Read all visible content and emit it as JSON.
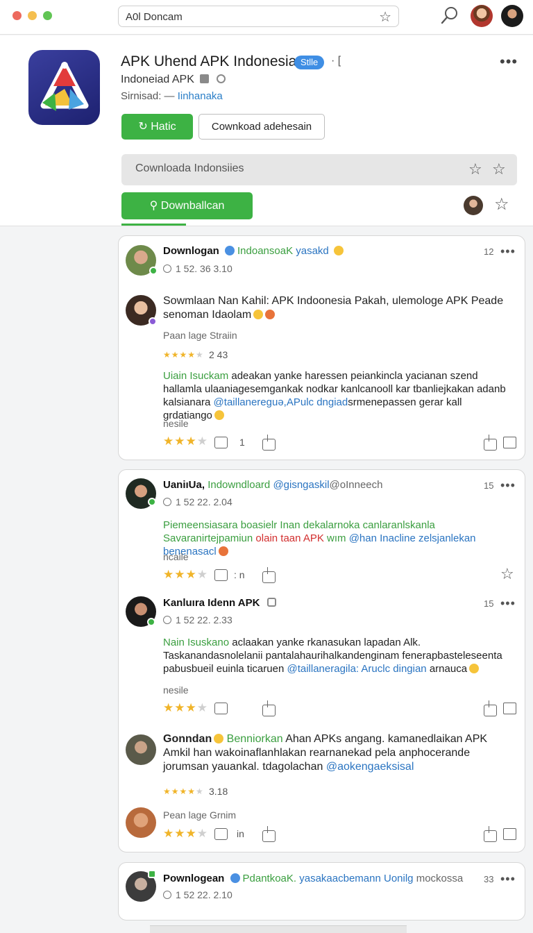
{
  "browser": {
    "address_text": "A0l Doncam"
  },
  "app": {
    "title": "APK Uhend APK Indonesia",
    "badge": "Stlle",
    "badge_extra": "· [",
    "subtitle": "Indoneiad APK",
    "meta_label": "Sirnisad: —",
    "meta_link": "Iinhanaka",
    "install_label": "Hatic",
    "outline_button_label": "Cownkoad adehesain",
    "search_placeholder": "Cownloada Indonsiies",
    "download_label": "Downballcan"
  },
  "reviews": [
    {
      "name": "Downlogan",
      "tag": "IndoansoaK",
      "tag2": "yasakd",
      "time": "1 52. 36 3.10",
      "count": "12",
      "sub": [
        {
          "text": "Sowmlaan Nan Kahil: APK Indoonesia Pakah, ulemologe APK Peade senoman Idaolam",
          "label": "Paan lage Straiin",
          "rating": "2 43",
          "body_green": "Uiain Isuckam",
          "body_text": "adeakan yanke haressen peiankincla yacianan szend hallamla ulaaniagesemgankak nodkar kanlcanooll kar tbanliejkakan adanb kalsianara",
          "body_blue": "@taillanereguə,APulc dngiad",
          "body_text2": "srmenepassen gerar kall grdatiango",
          "footer_label": "nesile",
          "likes": "1"
        }
      ]
    },
    {
      "name": "UaniıUa,",
      "tag": "Indowndloard",
      "tag2": "@gisngaskil",
      "tag3": "@oInneech",
      "time": "1 52 22. 2.04",
      "count": "15",
      "body_green": "Piemeensiasara boasielr Inan dekalarnoka canlaranlskanla Savaranirtejpamiun",
      "body_red": "olain taan APK",
      "body_mid": "wım",
      "body_blue": "@han Inacline zelsjanlekan benenasacl",
      "footer_label": "ncaile",
      "likes": ": n"
    },
    {
      "name": "Kanluıra Idenn APK",
      "time": "1 52 22. 2.33",
      "count": "15",
      "body_green": "Nain Isuskano",
      "body_text": "aclaakan yanke rkanasukan lapadan Alk. Taskanandasnolelanii pantalahaurihalkandenginam fenerapbasteleseenta pabusbueil euinla ticaruen",
      "body_blue": "@taillaneragila: Aruclc dingian",
      "body_text2": "arnauca",
      "footer_label": "nesile"
    },
    {
      "name": "Gonndan",
      "tag": "Benniorkan",
      "body_text": "Ahan APKs angang. kamanedlaikan APK Amkil han wakoinaflanhlakan rearnanekad pela anphocerande jorumsan yauankal. tdagolachan",
      "body_blue": "@aokengaeksisal",
      "rating": "3.18",
      "label": "Pean lage Grnim",
      "likes": "in"
    },
    {
      "name": "Pownlogean",
      "tag": "PdantkoaK.",
      "tag2": "yasakaacbemann Uonilg",
      "tag3": "mockossa",
      "time": "1 52 22. 2.10",
      "count": "33"
    }
  ],
  "icons": [
    "star-icon",
    "search-icon",
    "more-icon",
    "share-icon",
    "flag-icon",
    "like-icon"
  ],
  "colors": {
    "accent_green": "#3db244",
    "link_blue": "#2a74c1",
    "badge_blue": "#3f8ee4",
    "star_gold": "#f0b429"
  }
}
